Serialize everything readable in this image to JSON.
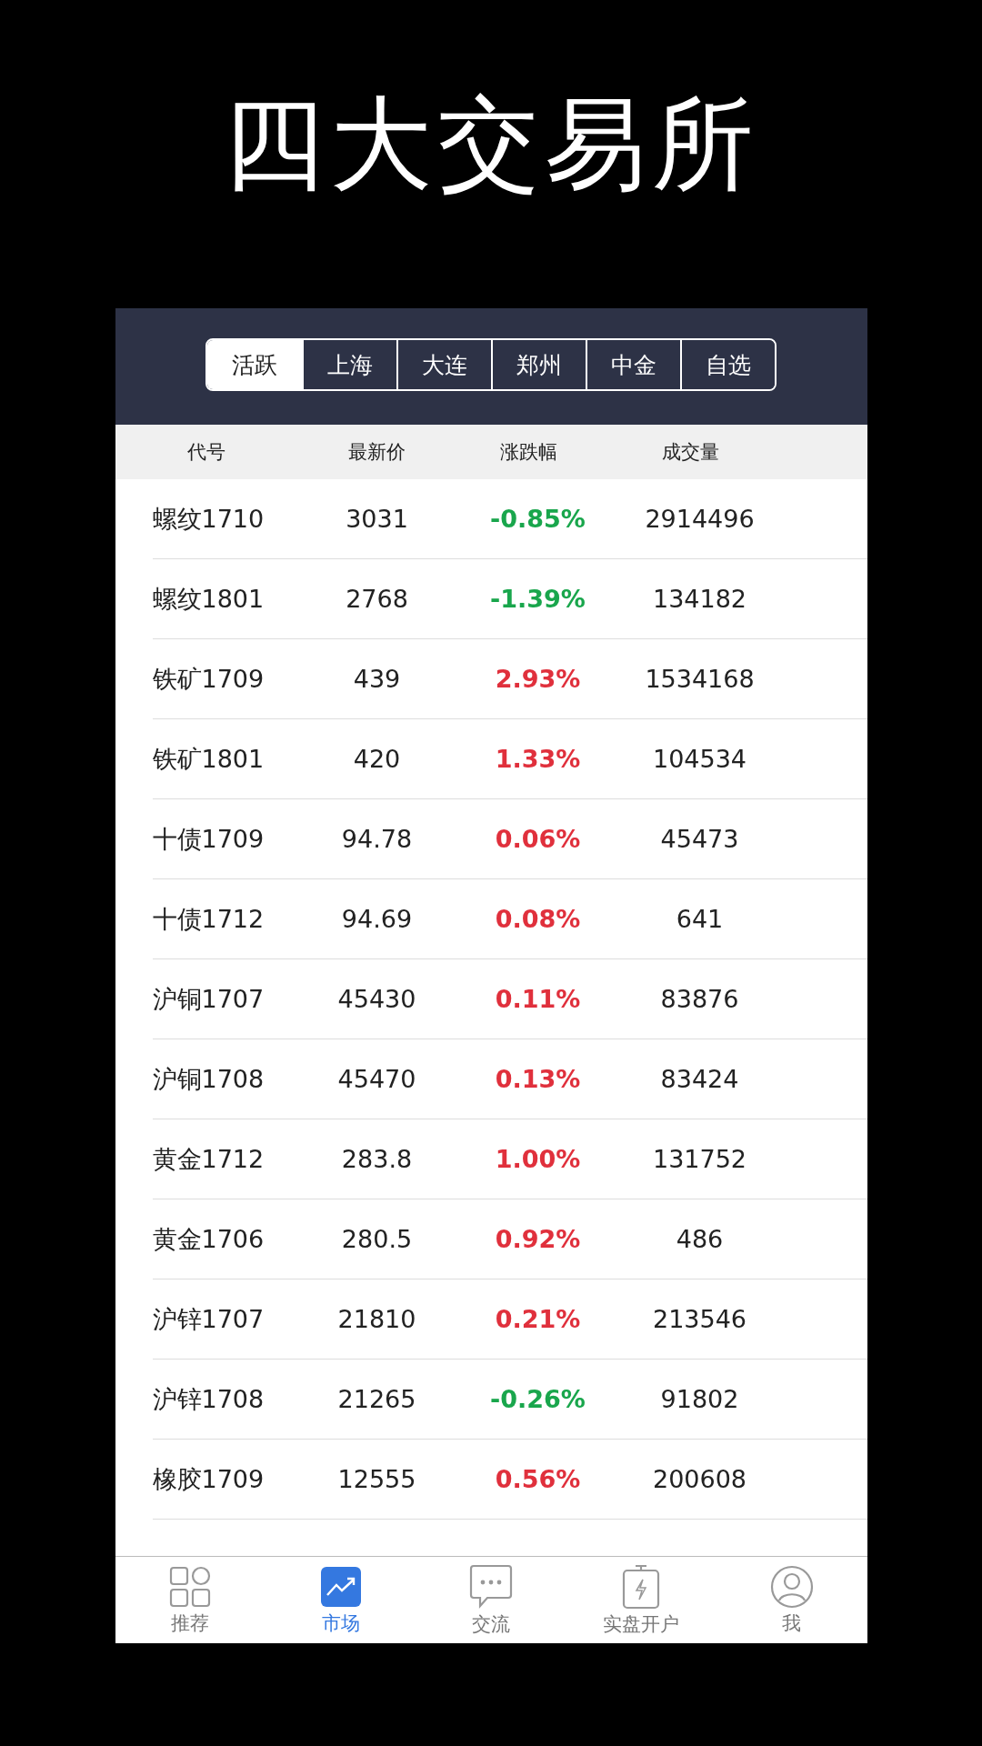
{
  "headline": "四大交易所",
  "exchange_tabs": [
    {
      "label": "活跃",
      "selected": true
    },
    {
      "label": "上海",
      "selected": false
    },
    {
      "label": "大连",
      "selected": false
    },
    {
      "label": "郑州",
      "selected": false
    },
    {
      "label": "中金",
      "selected": false
    },
    {
      "label": "自选",
      "selected": false
    }
  ],
  "table": {
    "columns": [
      "代号",
      "最新价",
      "涨跌幅",
      "成交量"
    ],
    "rows": [
      {
        "code": "螺纹1710",
        "price": "3031",
        "change": "-0.85%",
        "color": "#19a64c",
        "volume": "2914496"
      },
      {
        "code": "螺纹1801",
        "price": "2768",
        "change": "-1.39%",
        "color": "#19a64c",
        "volume": "134182"
      },
      {
        "code": "铁矿1709",
        "price": "439",
        "change": "2.93%",
        "color": "#e0303c",
        "volume": "1534168"
      },
      {
        "code": "铁矿1801",
        "price": "420",
        "change": "1.33%",
        "color": "#e0303c",
        "volume": "104534"
      },
      {
        "code": "十债1709",
        "price": "94.78",
        "change": "0.06%",
        "color": "#e0303c",
        "volume": "45473"
      },
      {
        "code": "十债1712",
        "price": "94.69",
        "change": "0.08%",
        "color": "#e0303c",
        "volume": "641"
      },
      {
        "code": "沪铜1707",
        "price": "45430",
        "change": "0.11%",
        "color": "#e0303c",
        "volume": "83876"
      },
      {
        "code": "沪铜1708",
        "price": "45470",
        "change": "0.13%",
        "color": "#e0303c",
        "volume": "83424"
      },
      {
        "code": "黄金1712",
        "price": "283.8",
        "change": "1.00%",
        "color": "#e0303c",
        "volume": "131752"
      },
      {
        "code": "黄金1706",
        "price": "280.5",
        "change": "0.92%",
        "color": "#e0303c",
        "volume": "486"
      },
      {
        "code": "沪锌1707",
        "price": "21810",
        "change": "0.21%",
        "color": "#e0303c",
        "volume": "213546"
      },
      {
        "code": "沪锌1708",
        "price": "21265",
        "change": "-0.26%",
        "color": "#19a64c",
        "volume": "91802"
      },
      {
        "code": "橡胶1709",
        "price": "12555",
        "change": "0.56%",
        "color": "#e0303c",
        "volume": "200608"
      }
    ]
  },
  "bottom_nav": [
    {
      "label": "推荐",
      "selected": false
    },
    {
      "label": "市场",
      "selected": true
    },
    {
      "label": "交流",
      "selected": false
    },
    {
      "label": "实盘开户",
      "selected": false
    },
    {
      "label": "我",
      "selected": false
    }
  ]
}
